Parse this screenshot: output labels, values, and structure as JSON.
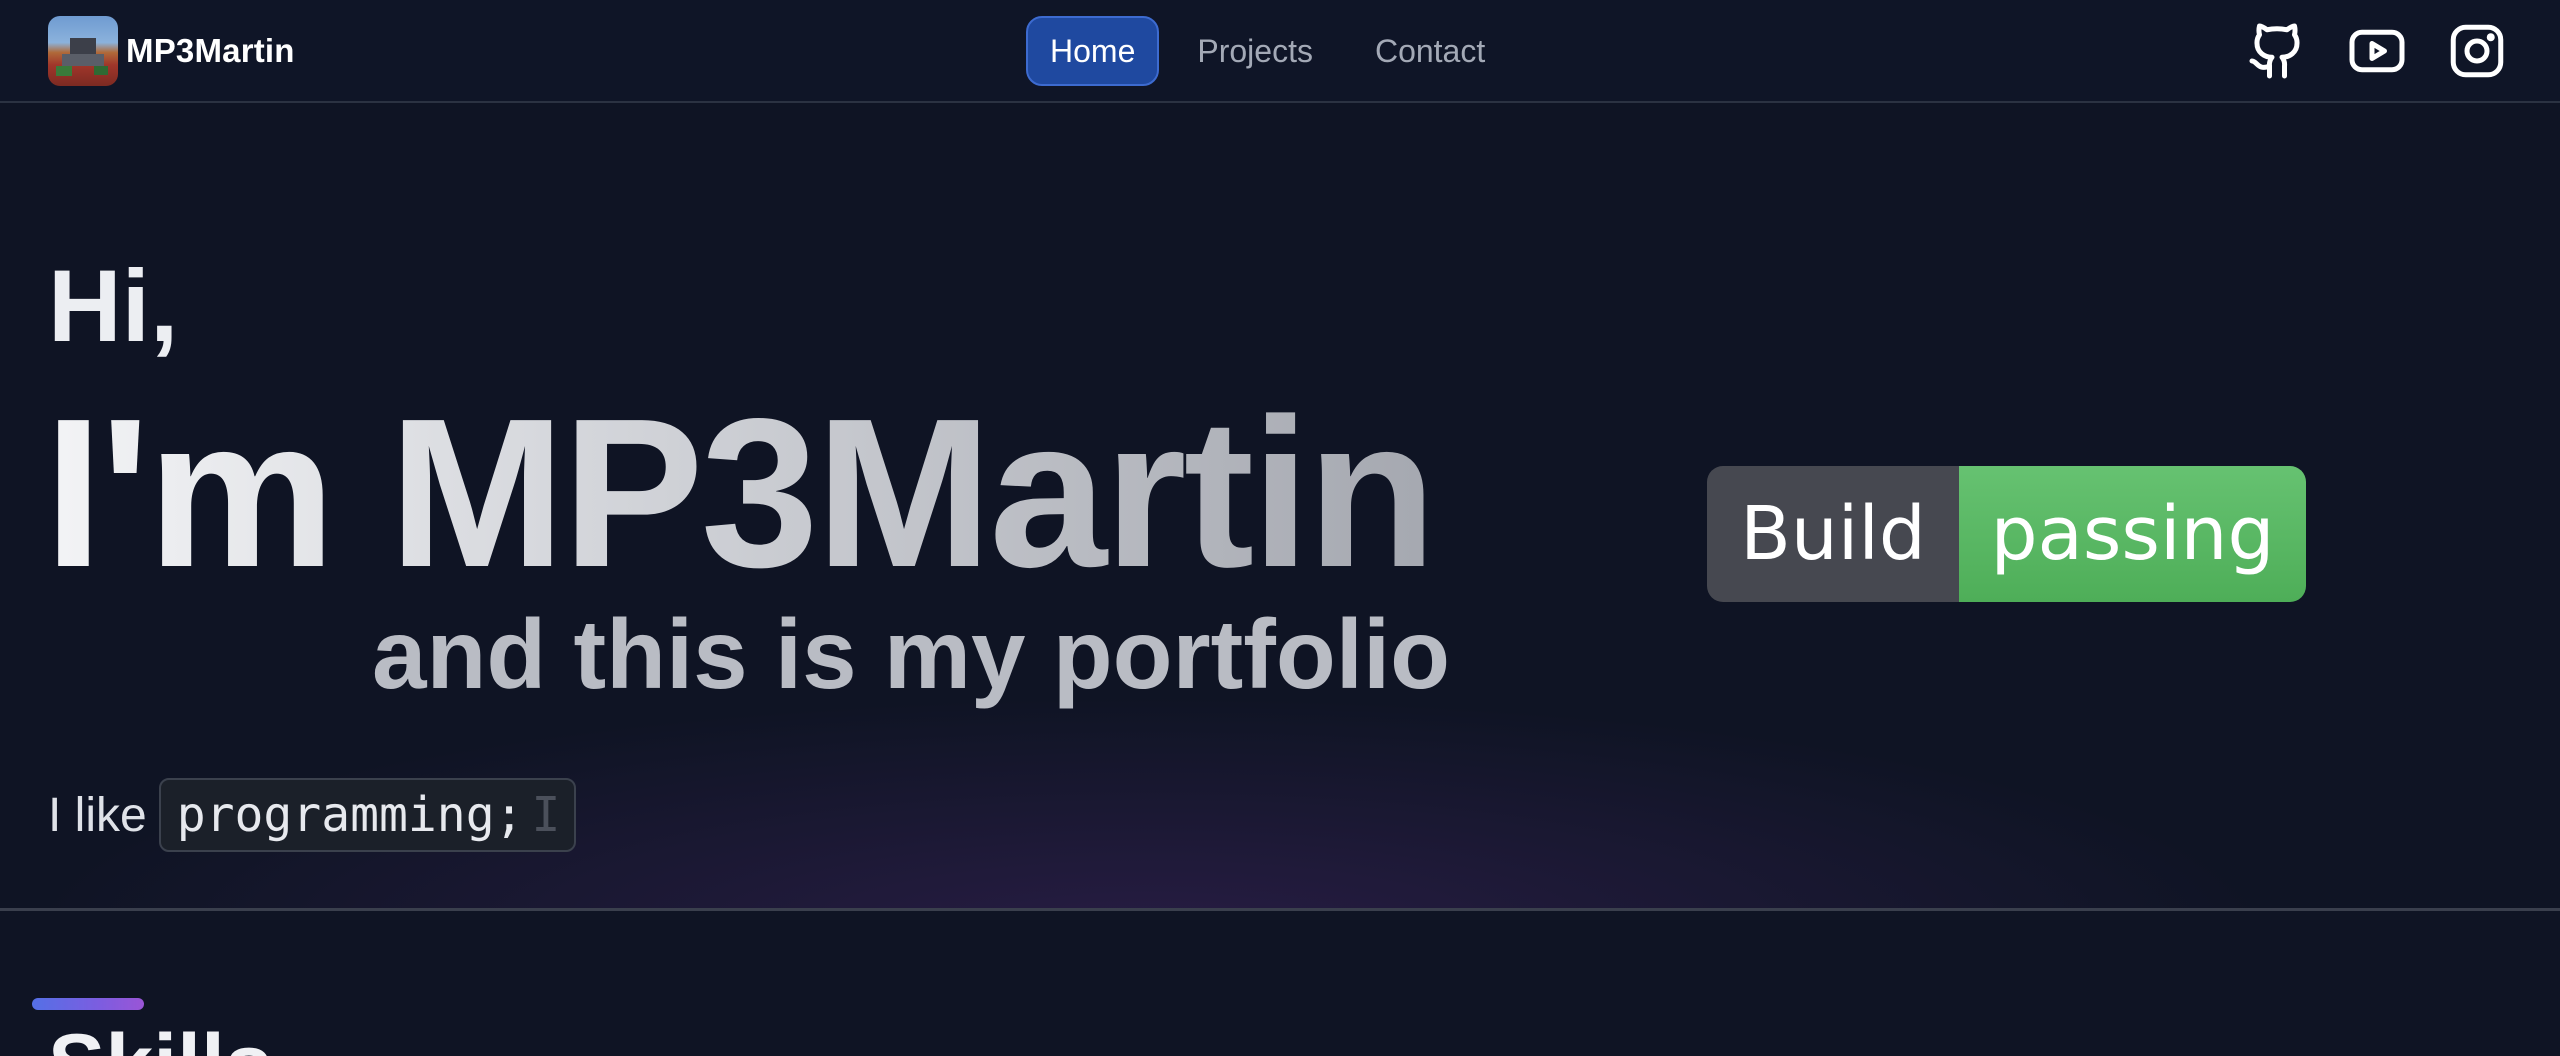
{
  "navbar": {
    "brand": {
      "name": "MP3Martin"
    },
    "links": [
      {
        "label": "Home",
        "active": true
      },
      {
        "label": "Projects",
        "active": false
      },
      {
        "label": "Contact",
        "active": false
      }
    ],
    "social_icons": [
      "github-icon",
      "youtube-icon",
      "instagram-icon"
    ]
  },
  "hero": {
    "greeting": "Hi,",
    "headline": "I'm MP3Martin",
    "subtitle": "and this is my portfolio",
    "like_prefix": "I like",
    "like_value": "programming;",
    "badge": {
      "left": "Build",
      "right": "passing"
    }
  },
  "skills": {
    "title": "Skills"
  },
  "colors": {
    "background": "#0f1424",
    "active_nav": "#1f49a0",
    "badge_left": "#464850",
    "badge_right": "#5cb865",
    "accent_bar": "#5470e6"
  }
}
